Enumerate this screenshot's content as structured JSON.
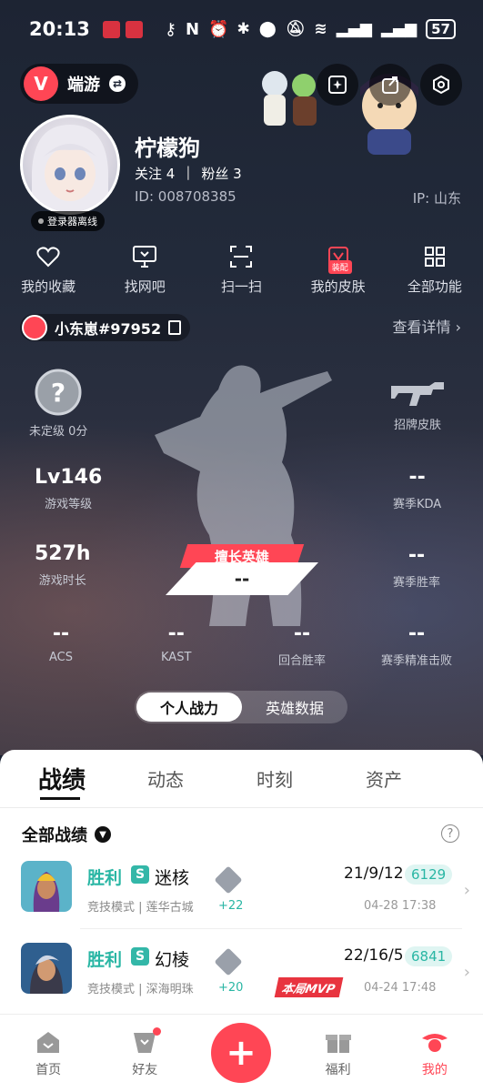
{
  "status_bar": {
    "time": "20:13",
    "battery": "57"
  },
  "header": {
    "game_label": "端游"
  },
  "profile": {
    "name": "柠檬狗",
    "follow_label": "关注 4",
    "fans_label": "粉丝 3",
    "id_label": "ID:  008708385",
    "ip_label": "IP:  山东",
    "offline_label": "登录器离线"
  },
  "quick_actions": [
    {
      "label": "我的收藏",
      "icon": "heart-icon"
    },
    {
      "label": "找网吧",
      "icon": "monitor-icon"
    },
    {
      "label": "扫一扫",
      "icon": "scan-icon"
    },
    {
      "label": "我的皮肤",
      "icon": "skin-icon",
      "tag": "装配"
    },
    {
      "label": "全部功能",
      "icon": "grid-icon"
    }
  ],
  "riot": {
    "name": "小东崽#97952",
    "detail_link": "查看详情"
  },
  "stats": {
    "rank_label": "未定级 0分",
    "skin_label": "招牌皮肤",
    "level_value": "Lv146",
    "level_label": "游戏等级",
    "kda_value": "--",
    "kda_label": "赛季KDA",
    "hours_value": "527h",
    "hours_label": "游戏时长",
    "winrate_value": "--",
    "winrate_label": "赛季胜率",
    "acs_value": "--",
    "acs_label": "ACS",
    "kast_value": "--",
    "kast_label": "KAST",
    "round_win_value": "--",
    "round_win_label": "回合胜率",
    "precise_value": "--",
    "precise_label": "赛季精准击败",
    "hero_banner": "擅长英雄",
    "hero_value": "--"
  },
  "toggle": {
    "active": "个人战力",
    "inactive": "英雄数据"
  },
  "sheet_tabs": [
    "战绩",
    "动态",
    "时刻",
    "资产"
  ],
  "filter_label": "全部战绩",
  "matches": [
    {
      "result": "胜利",
      "map": "迷核",
      "mode": "竞技模式 | 莲华古城",
      "delta": "+22",
      "kda": "21/9/12",
      "score": "6129",
      "time": "04-28 17:38",
      "mvp": ""
    },
    {
      "result": "胜利",
      "map": "幻棱",
      "mode": "竞技模式 | 深海明珠",
      "delta": "+20",
      "kda": "22/16/5",
      "score": "6841",
      "time": "04-24 17:48",
      "mvp": "本局MVP"
    }
  ],
  "nav": [
    {
      "label": "首页",
      "icon": "home-icon"
    },
    {
      "label": "好友",
      "icon": "friends-icon"
    },
    {
      "label": "福利",
      "icon": "gift-icon"
    },
    {
      "label": "我的",
      "icon": "profile-icon"
    }
  ],
  "colors": {
    "accent": "#ff4655",
    "win": "#29b6a4"
  }
}
